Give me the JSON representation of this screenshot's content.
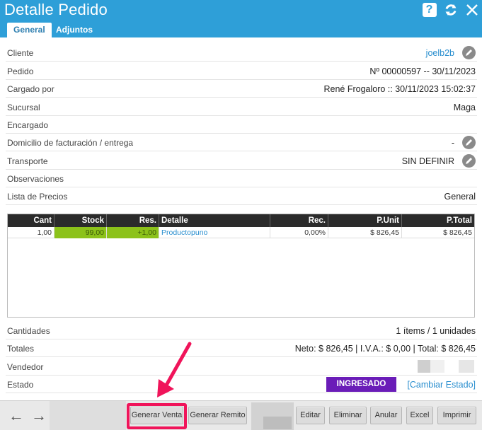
{
  "window": {
    "title": "Detalle Pedido",
    "help_glyph": "?"
  },
  "tabs": [
    {
      "label": "General"
    },
    {
      "label": "Adjuntos"
    }
  ],
  "fields": {
    "cliente": {
      "label": "Cliente",
      "value": "joelb2b"
    },
    "pedido": {
      "label": "Pedido",
      "value": "Nº 00000597 -- 30/11/2023"
    },
    "cargado": {
      "label": "Cargado por",
      "value": "René Frogaloro :: 30/11/2023 15:02:37"
    },
    "sucursal": {
      "label": "Sucursal",
      "value": "Maga"
    },
    "encargado": {
      "label": "Encargado",
      "value": ""
    },
    "domicilio": {
      "label": "Domicilio de facturación / entrega",
      "value": "-"
    },
    "transporte": {
      "label": "Transporte",
      "value": "SIN DEFINIR"
    },
    "observaciones": {
      "label": "Observaciones",
      "value": ""
    },
    "lista_precios": {
      "label": "Lista de Precios",
      "value": "General"
    }
  },
  "grid": {
    "headers": [
      "Cant",
      "Stock",
      "Res.",
      "Detalle",
      "Rec.",
      "P.Unit",
      "P.Total"
    ],
    "rows": [
      {
        "cant": "1,00",
        "stock": "99,00",
        "res": "+1,00",
        "detalle": "Productopuno",
        "rec": "0,00%",
        "punit": "$ 826,45",
        "ptotal": "$ 826,45"
      }
    ]
  },
  "summary": {
    "cantidades": {
      "label": "Cantidades",
      "value": "1 ítems / 1 unidades"
    },
    "totales": {
      "label": "Totales",
      "value": "Neto: $ 826,45 | I.V.A.: $ 0,00 | Total: $ 826,45"
    },
    "vendedor": {
      "label": "Vendedor"
    },
    "estado": {
      "label": "Estado",
      "status": "INGRESADO",
      "change_link": "[Cambiar Estado]"
    }
  },
  "toolbar": {
    "back_glyph": "←",
    "forward_glyph": "→",
    "buttons": {
      "generar_venta": "Generar Venta",
      "generar_remito": "Generar Remito",
      "editar": "Editar",
      "eliminar": "Eliminar",
      "anular": "Anular",
      "excel": "Excel",
      "imprimir": "Imprimir"
    }
  },
  "colors": {
    "titlebar": "#2e9fd8",
    "status_badge": "#6a1cb8",
    "stock_highlight": "#8cc21a",
    "annotation": "#f0145a",
    "link": "#2a8fcf"
  }
}
